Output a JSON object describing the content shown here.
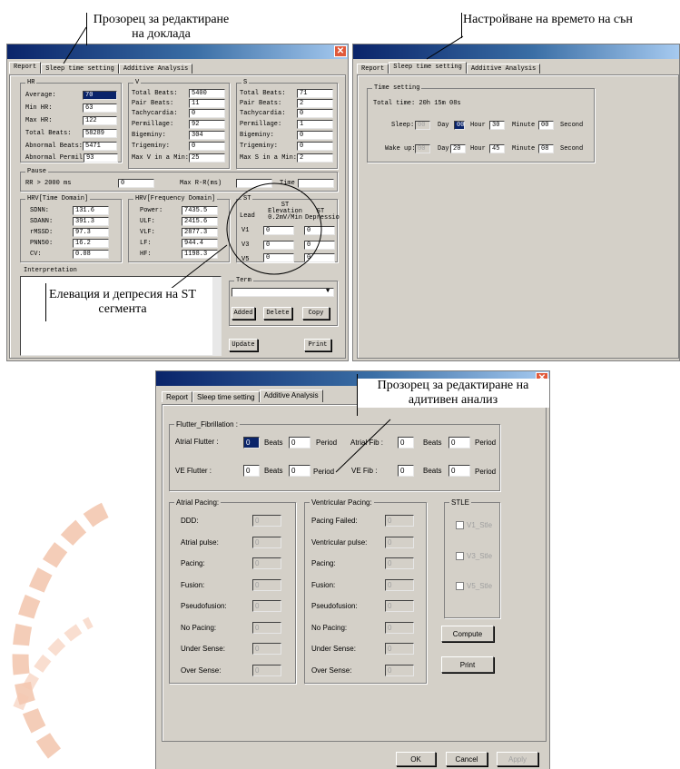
{
  "callouts": {
    "report_editor": "Прозорец за редактиране на доклада",
    "sleep_time": "Настройване на времето на сън",
    "st_segment": "Елевация и депресия на ST сегмента",
    "additive_editor": "Прозорец за редактиране на адитивен анализ"
  },
  "tabs": {
    "report": "Report",
    "sleep": "Sleep time setting",
    "additive": "Additive Analysis"
  },
  "w1": {
    "hr": {
      "title": "HR",
      "average_l": "Average:",
      "average_v": "70",
      "min_l": "Min HR:",
      "min_v": "63",
      "max_l": "Max HR:",
      "max_v": "122",
      "total_l": "Total Beats:",
      "total_v": "58289",
      "abn_l": "Abnormal Beats:",
      "abn_v": "5471",
      "abnp_l": "Abnormal Permilla",
      "abnp_v": "93"
    },
    "v": {
      "title": "V",
      "total_l": "Total Beats:",
      "total_v": "5400",
      "pair_l": "Pair Beats:",
      "pair_v": "11",
      "tachy_l": "Tachycardia:",
      "tachy_v": "0",
      "perm_l": "Permillage:",
      "perm_v": "92",
      "big_l": "Bigeminy:",
      "big_v": "304",
      "tri_l": "Trigeminy:",
      "tri_v": "0",
      "max_l": "Max V in a Min:",
      "max_v": "25"
    },
    "s": {
      "title": "S",
      "total_l": "Total Beats:",
      "total_v": "71",
      "pair_l": "Pair Beats:",
      "pair_v": "2",
      "tachy_l": "Tachycardia:",
      "tachy_v": "0",
      "perm_l": "Permillage:",
      "perm_v": "1",
      "big_l": "Bigeminy:",
      "big_v": "0",
      "tri_l": "Trigeminy:",
      "tri_v": "0",
      "max_l": "Max S in a Min:",
      "max_v": "2"
    },
    "pause": {
      "title": "Pause",
      "rr_l": "RR > 2000 ms",
      "rr_v": "0",
      "maxrr_l": "Max R-R(ms)",
      "maxrr_v": "",
      "time_l": "Time",
      "time_v": ""
    },
    "hrvt": {
      "title": "HRV[Time Domain]",
      "sdnn_l": "SDNN:",
      "sdnn_v": "131.6",
      "sdann_l": "SDANN:",
      "sdann_v": "391.3",
      "rmssd_l": "rMSSD:",
      "rmssd_v": "97.3",
      "pnn_l": "PNN50:",
      "pnn_v": "16.2",
      "cv_l": "CV:",
      "cv_v": "0.08"
    },
    "hrvf": {
      "title": "HRV[Frequency Domain]",
      "power_l": "Power:",
      "power_v": "7435.5",
      "ulf_l": "ULF:",
      "ulf_v": "2415.6",
      "vlf_l": "VLF:",
      "vlf_v": "2877.3",
      "lf_l": "LF:",
      "lf_v": "944.4",
      "hf_l": "HF:",
      "hf_v": "1198.3"
    },
    "st": {
      "title": "ST",
      "lead": "Lead",
      "elev": "ST Elevation 0.2mV/Min",
      "dep": "ST Depressio",
      "v1": "V1",
      "v3": "V3",
      "v5": "V5",
      "v1e": "0",
      "v1d": "0",
      "v3e": "0",
      "v3d": "0",
      "v5e": "0",
      "v5d": "0"
    },
    "interp": "Interpretation",
    "term": "Term",
    "added": "Added",
    "delete": "Delete",
    "copy": "Copy",
    "update": "Update",
    "print": "Print"
  },
  "w2": {
    "group": "Time setting",
    "total": "Total time: 20h 15m 08s",
    "sleep_l": "Sleep:",
    "sleep_day": "00",
    "sleep_hour": "00",
    "sleep_min": "30",
    "sleep_sec": "00",
    "wake_l": "Wake up:",
    "wake_day": "00",
    "wake_hour": "20",
    "wake_min": "45",
    "wake_sec": "08",
    "day": "Day",
    "hour": "Hour",
    "minute": "Minute",
    "second": "Second"
  },
  "w3": {
    "flutter": {
      "title": "Flutter_Fibrillation :",
      "af_l": "Atrial Flutter :",
      "af_beats": "0",
      "af_period": "0",
      "afib_l": "Atrial Fib :",
      "afib_beats": "0",
      "afib_period": "0",
      "vf_l": "VE Flutter :",
      "vf_beats": "0",
      "vf_period": "0",
      "vfib_l": "VE Fib :",
      "vfib_beats": "0",
      "vfib_period": "0",
      "beats": "Beats",
      "period": "Period"
    },
    "atrial": {
      "title": "Atrial Pacing:",
      "items": [
        "DDD:",
        "Atrial pulse:",
        "Pacing:",
        "Fusion:",
        "Pseudofusion:",
        "No Pacing:",
        "Under Sense:",
        "Over Sense:"
      ],
      "value": "0"
    },
    "vent": {
      "title": "Ventricular Pacing:",
      "items": [
        "Pacing Failed:",
        "Ventricular pulse:",
        "Pacing:",
        "Fusion:",
        "Pseudofusion:",
        "No Pacing:",
        "Under Sense:",
        "Over Sense:"
      ],
      "value": "0"
    },
    "stle": {
      "title": "STLE",
      "v1": "V1_Stle",
      "v3": "V3_Stle",
      "v5": "V5_Stle"
    },
    "compute": "Compute",
    "print": "Print",
    "ok": "OK",
    "cancel": "Cancel",
    "apply": "Apply"
  }
}
